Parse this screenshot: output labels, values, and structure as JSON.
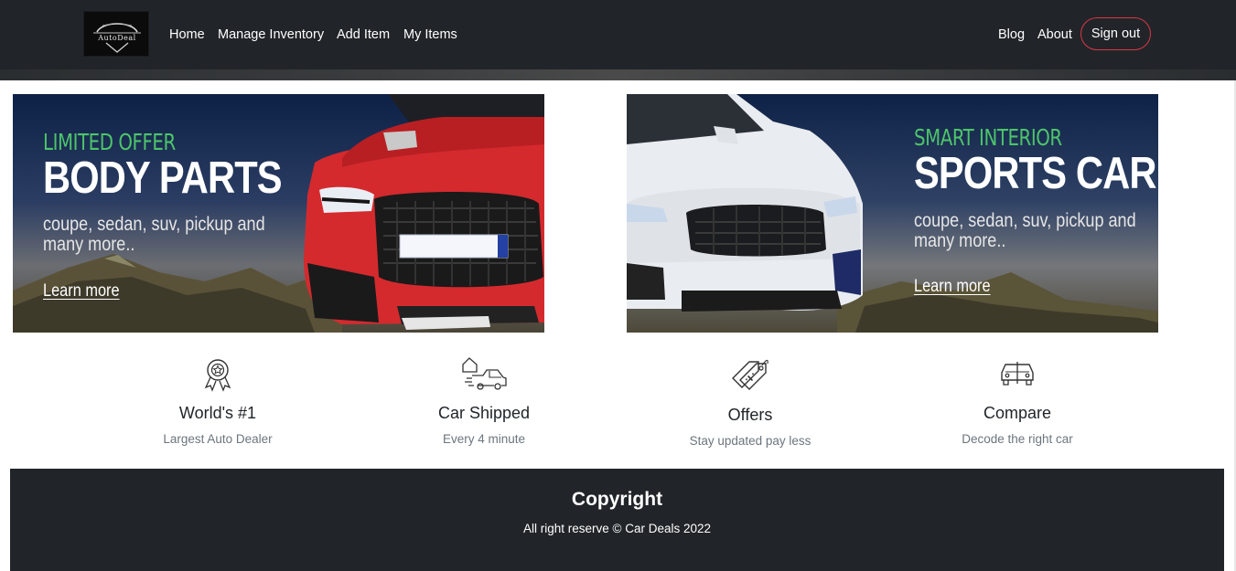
{
  "brand": {
    "logo_text": "AutoDeal",
    "logo_alt": "AutoDeal logo"
  },
  "nav": {
    "left": [
      {
        "label": "Home"
      },
      {
        "label": "Manage Inventory"
      },
      {
        "label": "Add Item"
      },
      {
        "label": "My Items"
      }
    ],
    "right": [
      {
        "label": "Blog"
      },
      {
        "label": "About"
      }
    ],
    "signout_label": "Sign out"
  },
  "banners": [
    {
      "kicker": "LIMITED OFFER",
      "title": "BODY PARTS",
      "description": "coupe, sedan, suv, pickup and many more..",
      "link": "Learn more",
      "car_color": "#d42a2e"
    },
    {
      "kicker": "SMART INTERIOR",
      "title": "SPORTS CAR",
      "description": "coupe, sedan, suv, pickup and many more..",
      "link": "Learn more",
      "car_color": "#e9ecf0"
    }
  ],
  "features": [
    {
      "icon": "award-ribbon-icon",
      "title": "World's #1",
      "subtitle": "Largest Auto Dealer"
    },
    {
      "icon": "car-shipping-icon",
      "title": "Car Shipped",
      "subtitle": "Every 4 minute"
    },
    {
      "icon": "price-tag-icon",
      "title": "Offers",
      "subtitle": "Stay updated pay less"
    },
    {
      "icon": "car-compare-icon",
      "title": "Compare",
      "subtitle": "Decode the right car"
    }
  ],
  "footer": {
    "title": "Copyright",
    "text": "All right reserve © Car Deals 2022"
  },
  "colors": {
    "navbar_bg": "#212529",
    "accent_red": "#dc3545",
    "kicker_green": "#4dc46a",
    "footer_bg": "#212529"
  }
}
